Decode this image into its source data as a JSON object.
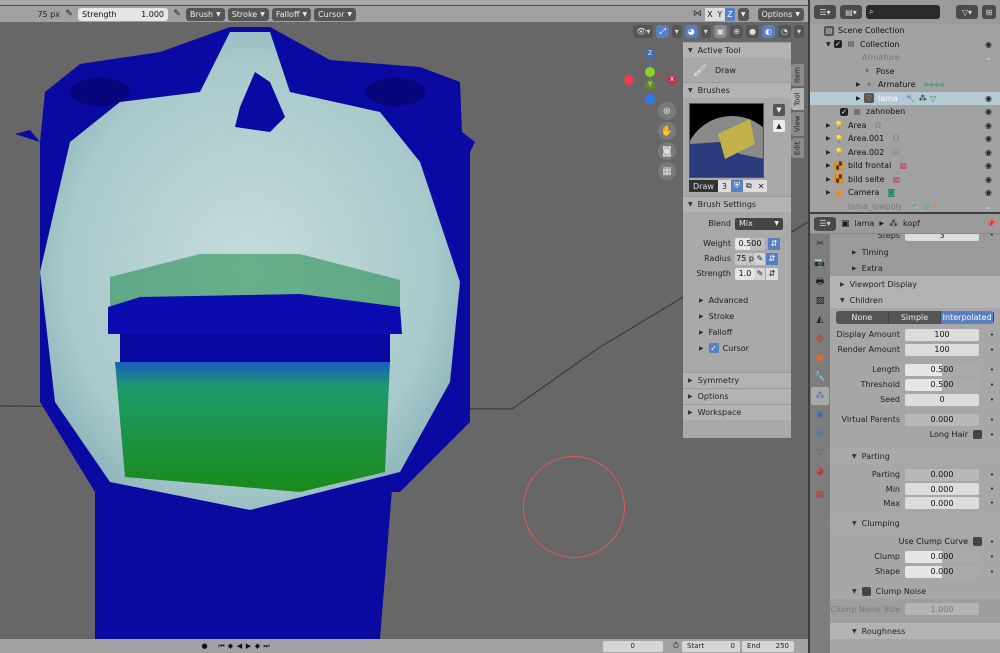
{
  "header": {
    "radius_value": "75 px",
    "strength_label": "Strength",
    "strength_value": "1.000",
    "menus": [
      "Brush",
      "Stroke",
      "Falloff",
      "Cursor"
    ],
    "axes": [
      "X",
      "Y",
      "Z"
    ],
    "active_axis": "Z",
    "options_label": "Options"
  },
  "viewport": {
    "gizmo_axes": {
      "z": "Z",
      "x": "X",
      "y": "Y"
    },
    "nav_icons": [
      "zoom-icon",
      "pan-hand-icon",
      "camera-icon",
      "grid-ortho-icon"
    ],
    "brush_cursor_color": "#e05a5a",
    "mesh_color": "#0a0a9a",
    "hair_color": "#b8d6d6",
    "weight_color": "#1c8a1c"
  },
  "npanel": {
    "tabs": [
      "Item",
      "Tool",
      "View",
      "Edit"
    ],
    "active_tab": "Tool",
    "active_tool_title": "Active Tool",
    "active_tool_name": "Draw",
    "brushes_title": "Brushes",
    "brush_name": "Draw",
    "brush_users": "3",
    "brush_settings_title": "Brush Settings",
    "blend_label": "Blend",
    "blend_value": "Mix",
    "weight_label": "Weight",
    "weight_value": "0.500",
    "radius_label": "Radius",
    "radius_value": "75 p",
    "strength_label": "Strength",
    "strength_value": "1.0",
    "subpanels": [
      "Advanced",
      "Stroke",
      "Falloff",
      "Cursor"
    ],
    "cursor_checked": true,
    "bottom_panels": [
      "Symmetry",
      "Options",
      "Workspace"
    ]
  },
  "timeline": {
    "current_frame": "0",
    "start_label": "Start",
    "start_value": "0",
    "end_label": "End",
    "end_value": "250"
  },
  "outliner": {
    "search_placeholder": "",
    "rows": [
      {
        "name": "Scene Collection",
        "type": "scene"
      },
      {
        "name": "Collection",
        "type": "collection"
      },
      {
        "name": "Armature",
        "type": "armature",
        "dim": true
      },
      {
        "name": "Pose",
        "type": "pose"
      },
      {
        "name": "Armature",
        "type": "armature-data"
      },
      {
        "name": "lama",
        "type": "mesh",
        "selected": true
      },
      {
        "name": "zahnoben",
        "type": "collection"
      },
      {
        "name": "Area",
        "type": "light"
      },
      {
        "name": "Area.001",
        "type": "light"
      },
      {
        "name": "Area.002",
        "type": "light"
      },
      {
        "name": "bild frontal",
        "type": "image"
      },
      {
        "name": "bild seite",
        "type": "image"
      },
      {
        "name": "Camera",
        "type": "camera"
      },
      {
        "name": "lama_lowpoly",
        "type": "mesh",
        "dim": true
      }
    ]
  },
  "properties": {
    "breadcrumb_object": "lama",
    "breadcrumb_data": "kopf",
    "steps_label": "Steps",
    "steps_value": "3",
    "timing_label": "Timing",
    "extra_label": "Extra",
    "viewport_display_label": "Viewport Display",
    "children_label": "Children",
    "children_modes": [
      "None",
      "Simple",
      "Interpolated"
    ],
    "children_active": "Interpolated",
    "display_amount_label": "Display Amount",
    "display_amount": "100",
    "render_amount_label": "Render Amount",
    "render_amount": "100",
    "length_label": "Length",
    "length_value": "0.500",
    "threshold_label": "Threshold",
    "threshold_value": "0.500",
    "seed_label": "Seed",
    "seed_value": "0",
    "virtual_parents_label": "Virtual Parents",
    "virtual_parents_value": "0.000",
    "long_hair_label": "Long Hair",
    "parting_title": "Parting",
    "parting_label": "Parting",
    "parting_value": "0.000",
    "min_label": "Min",
    "min_value": "0.000",
    "max_label": "Max",
    "max_value": "0.000",
    "clumping_title": "Clumping",
    "use_clump_curve_label": "Use Clump Curve",
    "clump_label": "Clump",
    "clump_value": "0.000",
    "shape_label": "Shape",
    "shape_value": "0.000",
    "clump_noise_label": "Clump Noise",
    "clump_noise_size_label": "Clump Noise Size",
    "clump_noise_size_value": "1.000",
    "roughness_title": "Roughness"
  }
}
